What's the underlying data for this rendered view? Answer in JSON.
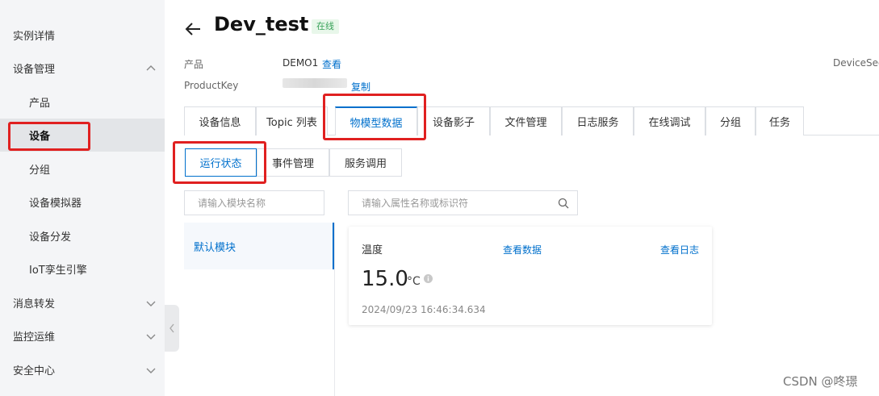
{
  "sidebar": {
    "items": [
      {
        "label": "实例详情",
        "level": "top",
        "chevron": ""
      },
      {
        "label": "设备管理",
        "level": "top",
        "chevron": "up"
      },
      {
        "label": "产品",
        "level": "sub",
        "chevron": ""
      },
      {
        "label": "设备",
        "level": "sub",
        "chevron": "",
        "active": true
      },
      {
        "label": "分组",
        "level": "sub",
        "chevron": ""
      },
      {
        "label": "设备模拟器",
        "level": "sub",
        "chevron": ""
      },
      {
        "label": "设备分发",
        "level": "sub",
        "chevron": ""
      },
      {
        "label": "IoT孪生引擎",
        "level": "sub",
        "chevron": ""
      },
      {
        "label": "消息转发",
        "level": "top",
        "chevron": "down"
      },
      {
        "label": "监控运维",
        "level": "top",
        "chevron": "down"
      },
      {
        "label": "安全中心",
        "level": "top",
        "chevron": "down"
      }
    ]
  },
  "header": {
    "title": "Dev_test",
    "status": "在线",
    "product_label": "产品",
    "product_value": "DEMO1",
    "product_link": "查看",
    "productkey_label": "ProductKey",
    "productkey_link": "复制",
    "secret_label": "DeviceSecr"
  },
  "tabs": [
    {
      "label": "设备信息"
    },
    {
      "label": "Topic 列表"
    },
    {
      "label": "物模型数据",
      "active": true
    },
    {
      "label": "设备影子"
    },
    {
      "label": "文件管理"
    },
    {
      "label": "日志服务"
    },
    {
      "label": "在线调试"
    },
    {
      "label": "分组"
    },
    {
      "label": "任务"
    }
  ],
  "subtabs": [
    {
      "label": "运行状态",
      "active": true
    },
    {
      "label": "事件管理"
    },
    {
      "label": "服务调用"
    }
  ],
  "module_search": {
    "placeholder": "请输入模块名称"
  },
  "property_search": {
    "placeholder": "请输入属性名称或标识符"
  },
  "modules": [
    {
      "label": "默认模块"
    }
  ],
  "property": {
    "name": "温度",
    "view_data_link": "查看数据",
    "view_log_link": "查看日志",
    "value": "15.0",
    "unit": "°C",
    "timestamp": "2024/09/23 16:46:34.634"
  },
  "watermark": "CSDN @咚璟",
  "colors": {
    "accent": "#0070cc",
    "highlight": "#e02020",
    "online": "#3aa35a"
  }
}
